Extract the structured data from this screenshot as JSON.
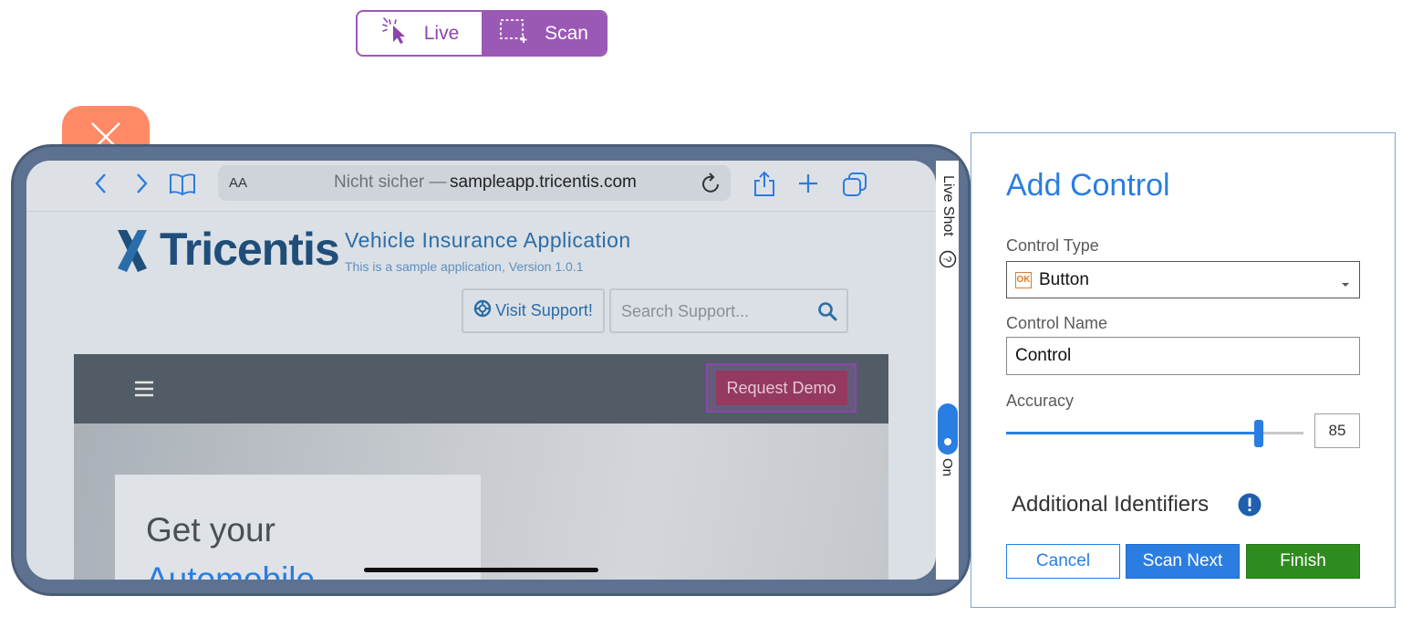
{
  "mode_toggle": {
    "live_label": "Live",
    "scan_label": "Scan",
    "active": "Scan"
  },
  "browser": {
    "text_size_label": "AA",
    "url_prefix": "Nicht sicher —",
    "url_domain": "sampleapp.tricentis.com"
  },
  "page": {
    "logo_text": "Tricentis",
    "app_title": "Vehicle Insurance Application",
    "app_subtitle": "This is a sample application, Version 1.0.1",
    "visit_support_label": "Visit Support!",
    "search_placeholder": "Search Support...",
    "request_demo_label": "Request Demo",
    "hero_heading_line1": "Get your",
    "hero_heading_line2": "Automobile"
  },
  "side_panel": {
    "live_shot_label": "Live Shot",
    "toggle_state_label": "On"
  },
  "add_control": {
    "title": "Add Control",
    "control_type_label": "Control Type",
    "control_type_value": "Button",
    "control_type_icon_text": "OK",
    "control_name_label": "Control Name",
    "control_name_value": "Control",
    "accuracy_label": "Accuracy",
    "accuracy_value": "85",
    "accuracy_fraction": 0.85,
    "additional_identifiers_label": "Additional Identifiers",
    "cancel_label": "Cancel",
    "scan_next_label": "Scan Next",
    "finish_label": "Finish"
  },
  "colors": {
    "accent_purple": "#9b59b6",
    "primary_blue": "#2a7de1",
    "finish_green": "#2e8b1e",
    "brand_navy": "#1f4e7a"
  }
}
